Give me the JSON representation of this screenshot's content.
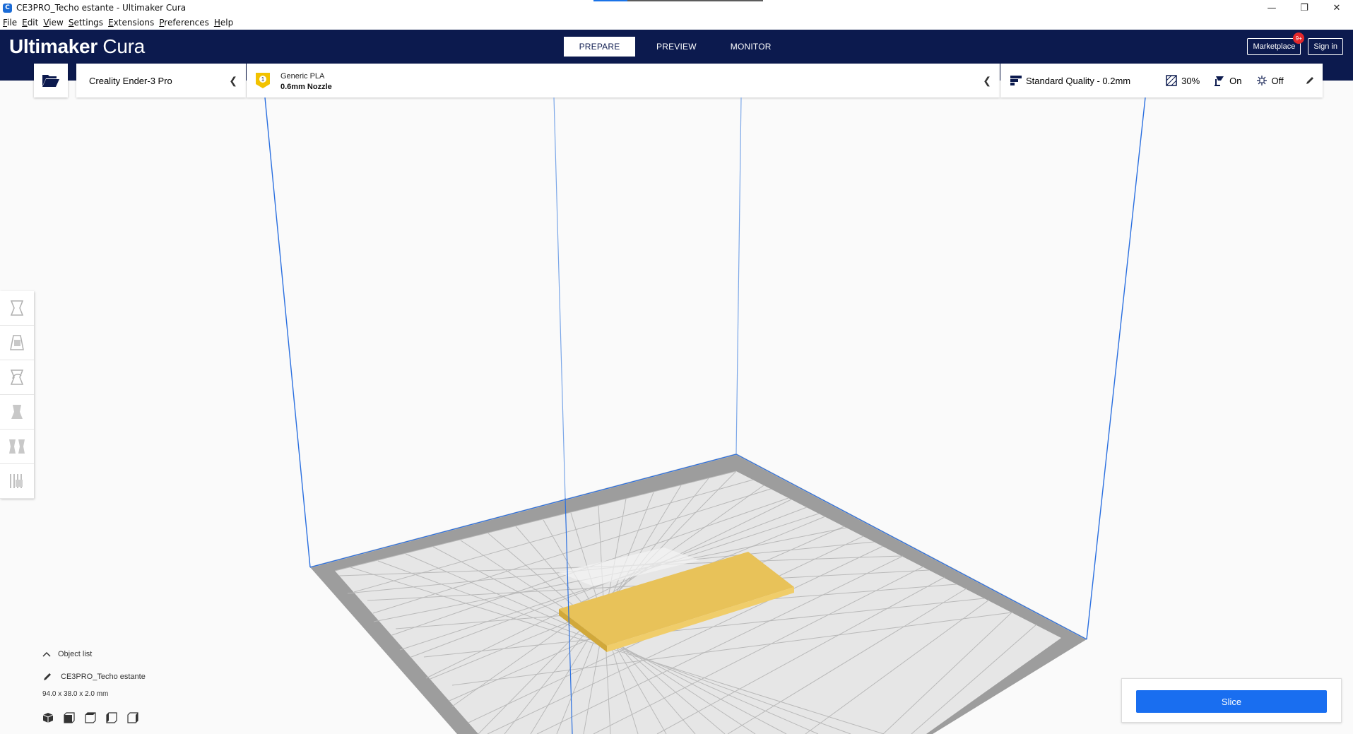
{
  "window": {
    "title": "CE3PRO_Techo estante - Ultimaker Cura",
    "app_icon": "C",
    "minimize": "—",
    "restore": "❐",
    "close": "✕"
  },
  "menu": [
    "File",
    "Edit",
    "View",
    "Settings",
    "Extensions",
    "Preferences",
    "Help"
  ],
  "header": {
    "logo_bold": "Ultimaker",
    "logo_light": " Cura",
    "tabs": [
      "PREPARE",
      "PREVIEW",
      "MONITOR"
    ],
    "active_tab": "PREPARE",
    "marketplace": "Marketplace",
    "marketplace_badge": "9+",
    "signin": "Sign in"
  },
  "printer": {
    "name": "Creality Ender-3 Pro"
  },
  "material": {
    "extruder_number": "1",
    "name": "Generic PLA",
    "nozzle": "0.6mm Nozzle"
  },
  "print_settings": {
    "profile": "Standard Quality - 0.2mm",
    "infill": "30%",
    "support": "On",
    "adhesion": "Off"
  },
  "tools": [
    "move-tool",
    "scale-tool",
    "rotate-tool",
    "mirror-tool",
    "per-model-settings-tool",
    "support-blocker-tool"
  ],
  "object_list": {
    "toggle_label": "Object list",
    "object_name": "CE3PRO_Techo estante",
    "dimensions": "94.0 x 38.0 x 2.0 mm"
  },
  "slice": {
    "label": "Slice"
  },
  "colors": {
    "header_bg": "#0c1a4e",
    "slice_blue": "#196ef0",
    "model_yellow": "#f2c75c",
    "volume_blue": "#2a6fe0"
  }
}
